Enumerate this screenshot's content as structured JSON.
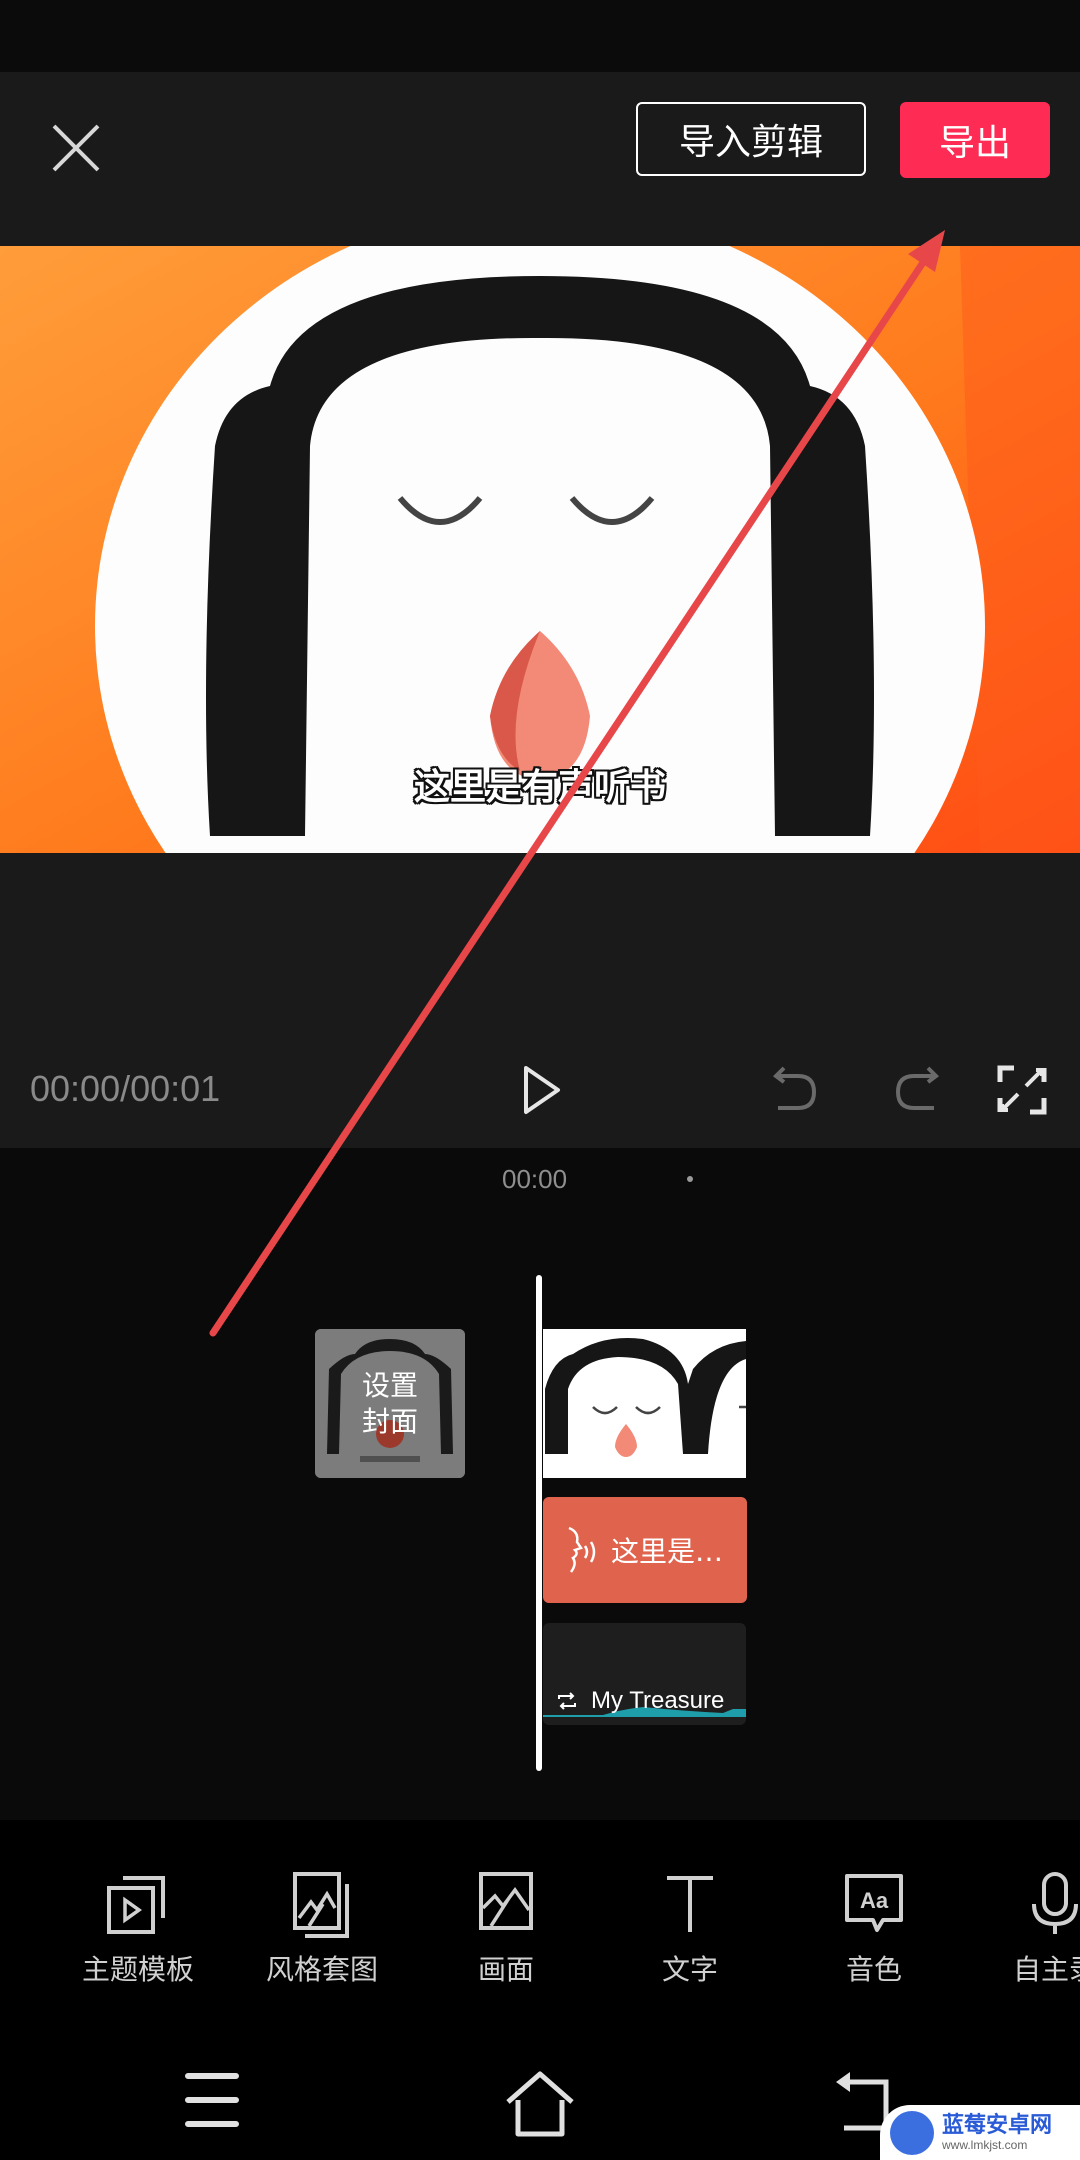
{
  "header": {
    "close_icon": "close-icon",
    "import_button": "导入剪辑",
    "export_button": "导出",
    "export_color": "#fe2c55"
  },
  "preview": {
    "subtitle": "这里是有声听书",
    "background_color": "#ff7f1f"
  },
  "player": {
    "time": "00:00/00:01",
    "play_icon": "play-icon",
    "undo_icon": "undo-icon",
    "redo_icon": "redo-icon",
    "fullscreen_icon": "fullscreen-icon"
  },
  "timeline": {
    "ruler_time": "00:00",
    "cover_label_line1": "设置",
    "cover_label_line2": "封面",
    "text_clip_label": "这里是…",
    "text_clip_color": "#e0634d",
    "audio_clip_label": "My Treasure",
    "audio_wave_color": "#1fb5c4"
  },
  "toolbar": {
    "items": [
      {
        "label": "主题模板",
        "icon": "theme-template-icon"
      },
      {
        "label": "风格套图",
        "icon": "style-set-icon"
      },
      {
        "label": "画面",
        "icon": "image-icon"
      },
      {
        "label": "文字",
        "icon": "text-icon"
      },
      {
        "label": "音色",
        "icon": "voice-tone-icon"
      },
      {
        "label": "自主录",
        "icon": "microphone-icon"
      }
    ]
  },
  "navbar": {
    "menu_icon": "menu-icon",
    "home_icon": "home-icon",
    "back_icon": "back-icon"
  },
  "watermark": {
    "title": "蓝莓安卓网",
    "url": "www.lmkjst.com"
  },
  "annotation": {
    "color": "#e8474a"
  }
}
